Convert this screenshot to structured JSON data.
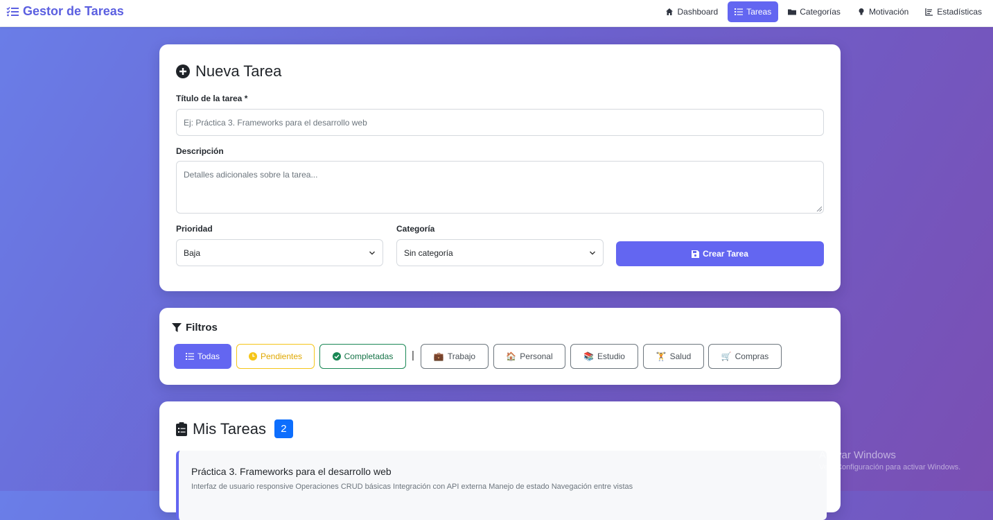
{
  "navbar": {
    "brand": "Gestor de Tareas",
    "items": [
      {
        "label": "Dashboard",
        "icon": "home-icon"
      },
      {
        "label": "Tareas",
        "icon": "list-icon",
        "active": true
      },
      {
        "label": "Categorías",
        "icon": "folder-icon"
      },
      {
        "label": "Motivación",
        "icon": "lightbulb-icon"
      },
      {
        "label": "Estadísticas",
        "icon": "chart-icon"
      }
    ]
  },
  "new_task": {
    "title": "Nueva Tarea",
    "title_label": "Título de la tarea *",
    "title_placeholder": "Ej: Práctica 3. Frameworks para el desarrollo web",
    "description_label": "Descripción",
    "description_placeholder": "Detalles adicionales sobre la tarea...",
    "priority_label": "Prioridad",
    "priority_value": "Baja",
    "category_label": "Categoría",
    "category_value": "Sin categoría",
    "submit_label": "Crear Tarea"
  },
  "filters": {
    "title": "Filtros",
    "status": [
      {
        "label": "Todas",
        "icon": "list-icon"
      },
      {
        "label": "Pendientes",
        "icon": "clock-icon"
      },
      {
        "label": "Completadas",
        "icon": "check-circle-icon"
      }
    ],
    "separator": "|",
    "categories": [
      {
        "label": "Trabajo",
        "icon": "💼"
      },
      {
        "label": "Personal",
        "icon": "🏠"
      },
      {
        "label": "Estudio",
        "icon": "📚"
      },
      {
        "label": "Salud",
        "icon": "🏋"
      },
      {
        "label": "Compras",
        "icon": "🛒"
      }
    ]
  },
  "tasks": {
    "title": "Mis Tareas",
    "count": "2",
    "items": [
      {
        "title": "Práctica 3. Frameworks para el desarrollo web",
        "description": "Interfaz de usuario responsive Operaciones CRUD básicas Integración con API externa Manejo de estado Navegación entre vistas"
      }
    ]
  },
  "watermark": {
    "title": "Activar Windows",
    "subtitle": "Ve a Configuración para activar Windows."
  },
  "colors": {
    "accent": "#6366f1",
    "badge": "#0d6efd",
    "pending": "#f5c518",
    "completed": "#198754"
  }
}
